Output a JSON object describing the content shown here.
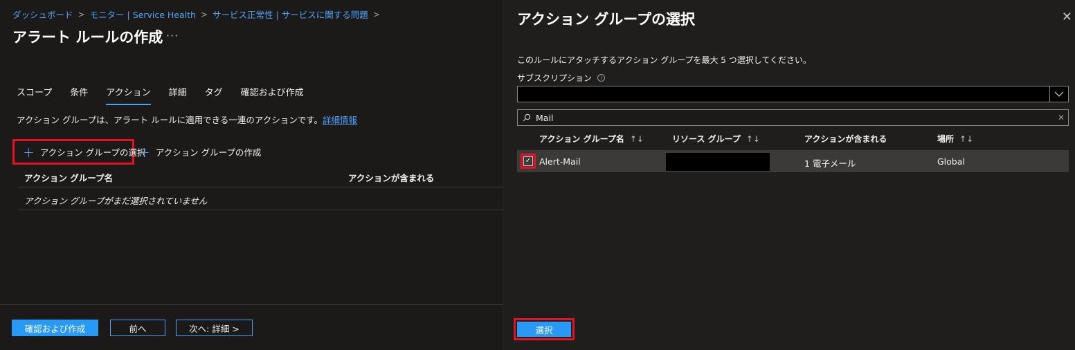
{
  "breadcrumb": [
    {
      "label": "ダッシュボード"
    },
    {
      "label": "モニター | Service Health"
    },
    {
      "label": "サービス正常性 | サービスに関する問題"
    }
  ],
  "page": {
    "title": "アラート ルールの作成",
    "more": "···"
  },
  "tabs": [
    {
      "label": "スコープ"
    },
    {
      "label": "条件"
    },
    {
      "label": "アクション"
    },
    {
      "label": "詳細"
    },
    {
      "label": "タグ"
    },
    {
      "label": "確認および作成"
    }
  ],
  "description": {
    "text": "アクション グループは、アラート ルールに適用できる一連のアクションです。",
    "link": "詳細情報"
  },
  "commands": {
    "select_group": "アクション グループの選択",
    "create_group": "アクション グループの作成"
  },
  "left_table": {
    "columns": [
      "アクション グループ名",
      "アクションが含まれる"
    ],
    "empty": "アクション グループがまだ選択されていません"
  },
  "footer": {
    "review_create": "確認および作成",
    "previous": "前へ",
    "next": "次へ: 詳細 >"
  },
  "panel": {
    "title": "アクション グループの選択",
    "close": "✕",
    "description": "このルールにアタッチするアクション グループを最大 5 つ選択してください。",
    "subscription_label": "サブスクリプション",
    "search_value": "Mail",
    "columns": [
      "アクション グループ名",
      "リソース グループ",
      "アクションが含まれる",
      "場所"
    ],
    "sort_glyph": "↑↓",
    "rows": [
      {
        "name": "Alert-Mail",
        "actions": "1 電子メール",
        "location": "Global",
        "checked": true
      }
    ],
    "select_button": "選択"
  },
  "colors": {
    "accent": "#4fa3f7",
    "primary": "#2899f5",
    "highlight": "#e81123",
    "background": "#1b1a19"
  }
}
